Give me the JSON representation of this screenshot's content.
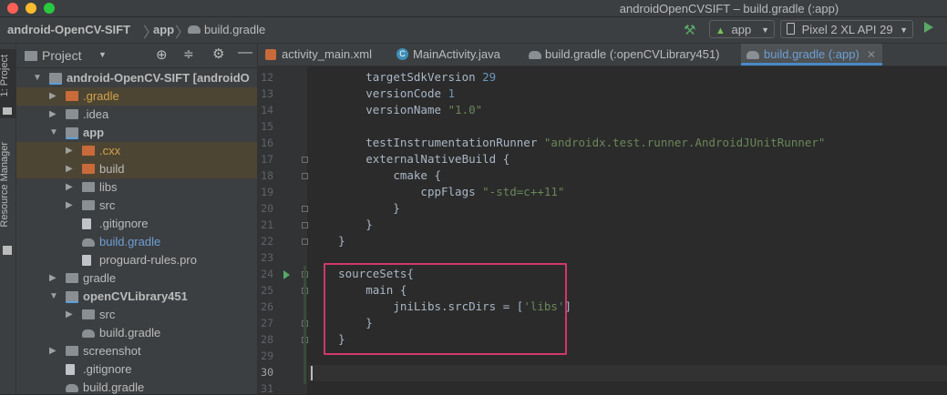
{
  "window": {
    "title": "androidOpenCVSIFT – build.gradle (:app)"
  },
  "navbar": {
    "breadcrumbs": [
      "android-OpenCV-SIFT",
      "app",
      "build.gradle"
    ],
    "run_config": "app",
    "device": "Pixel 2 XL API 29"
  },
  "stripe": {
    "project_tab": "1: Project",
    "resource_tab": "Resource Manager"
  },
  "project_panel": {
    "title": "Project",
    "tree": [
      {
        "label": "android-OpenCV-SIFT [androidO",
        "expanded": true,
        "icon": "module-folder-icon",
        "bold": true
      },
      {
        "label": ".gradle",
        "expanded": false,
        "icon": "excluded-folder-icon",
        "highlight": true,
        "color": "#d4a24b"
      },
      {
        "label": ".idea",
        "expanded": false,
        "icon": "folder-icon"
      },
      {
        "label": "app",
        "expanded": true,
        "icon": "module-folder-icon",
        "bold": true
      },
      {
        "label": ".cxx",
        "expanded": false,
        "icon": "excluded-folder-icon",
        "highlight": true,
        "color": "#d4a24b"
      },
      {
        "label": "build",
        "expanded": false,
        "icon": "excluded-folder-icon",
        "highlight": true
      },
      {
        "label": "libs",
        "expanded": false,
        "icon": "folder-icon"
      },
      {
        "label": "src",
        "expanded": false,
        "icon": "folder-icon"
      },
      {
        "label": ".gitignore",
        "icon": "gitignore-file-icon"
      },
      {
        "label": "build.gradle",
        "icon": "gradle-file-icon",
        "color": "#6d9fd5"
      },
      {
        "label": "proguard-rules.pro",
        "icon": "text-file-icon"
      },
      {
        "label": "gradle",
        "expanded": false,
        "icon": "folder-icon"
      },
      {
        "label": "openCVLibrary451",
        "expanded": true,
        "icon": "module-folder-icon",
        "bold": true
      },
      {
        "label": "src",
        "expanded": false,
        "icon": "folder-icon"
      },
      {
        "label": "build.gradle",
        "icon": "gradle-file-icon"
      },
      {
        "label": "screenshot",
        "expanded": false,
        "icon": "folder-icon"
      },
      {
        "label": ".gitignore",
        "icon": "gitignore-file-icon"
      },
      {
        "label": "build.gradle",
        "icon": "gradle-file-icon"
      }
    ]
  },
  "tabs": [
    {
      "label": "activity_main.xml",
      "icon": "xml-file-icon",
      "active": false
    },
    {
      "label": "MainActivity.java",
      "icon": "java-class-icon",
      "active": false
    },
    {
      "label": "build.gradle (:openCVLibrary451)",
      "icon": "gradle-file-icon",
      "active": false
    },
    {
      "label": "build.gradle (:app)",
      "icon": "gradle-file-icon",
      "active": true
    }
  ],
  "editor": {
    "lines": [
      {
        "n": "12",
        "tokens": [
          [
            "        ",
            ""
          ],
          [
            "targetSdkVersion ",
            ""
          ],
          [
            "29",
            "num"
          ]
        ]
      },
      {
        "n": "13",
        "tokens": [
          [
            "        ",
            ""
          ],
          [
            "versionCode ",
            ""
          ],
          [
            "1",
            "num"
          ]
        ]
      },
      {
        "n": "14",
        "tokens": [
          [
            "        ",
            ""
          ],
          [
            "versionName ",
            ""
          ],
          [
            "\"1.0\"",
            "str"
          ]
        ]
      },
      {
        "n": "15",
        "tokens": []
      },
      {
        "n": "16",
        "tokens": [
          [
            "        ",
            ""
          ],
          [
            "testInstrumentationRunner ",
            ""
          ],
          [
            "\"androidx.test.runner.AndroidJUnitRunner\"",
            "str"
          ]
        ]
      },
      {
        "n": "17",
        "tokens": [
          [
            "        ",
            ""
          ],
          [
            "externalNativeBuild {",
            ""
          ]
        ]
      },
      {
        "n": "18",
        "tokens": [
          [
            "            ",
            ""
          ],
          [
            "cmake {",
            ""
          ]
        ]
      },
      {
        "n": "19",
        "tokens": [
          [
            "                ",
            ""
          ],
          [
            "cppFlags ",
            ""
          ],
          [
            "\"-std=c++11\"",
            "str"
          ]
        ]
      },
      {
        "n": "20",
        "tokens": [
          [
            "            }",
            ""
          ]
        ]
      },
      {
        "n": "21",
        "tokens": [
          [
            "        }",
            ""
          ]
        ]
      },
      {
        "n": "22",
        "tokens": [
          [
            "    }",
            ""
          ]
        ]
      },
      {
        "n": "23",
        "tokens": []
      },
      {
        "n": "24",
        "tokens": [
          [
            "    ",
            ""
          ],
          [
            "sourceSets{",
            ""
          ]
        ]
      },
      {
        "n": "25",
        "tokens": [
          [
            "        ",
            ""
          ],
          [
            "main {",
            ""
          ]
        ]
      },
      {
        "n": "26",
        "tokens": [
          [
            "            ",
            ""
          ],
          [
            "jniLibs.srcDirs = [",
            ""
          ],
          [
            "'libs'",
            "str"
          ],
          [
            "]",
            ""
          ]
        ]
      },
      {
        "n": "27",
        "tokens": [
          [
            "        }",
            ""
          ]
        ]
      },
      {
        "n": "28",
        "tokens": [
          [
            "    }",
            ""
          ]
        ]
      },
      {
        "n": "29",
        "tokens": []
      },
      {
        "n": "30",
        "tokens": []
      },
      {
        "n": "31",
        "tokens": []
      }
    ],
    "current_line": "30"
  },
  "colors": {
    "accent": "#4a88c7",
    "highlight_box": "#d1376b",
    "run_green": "#59a869"
  }
}
